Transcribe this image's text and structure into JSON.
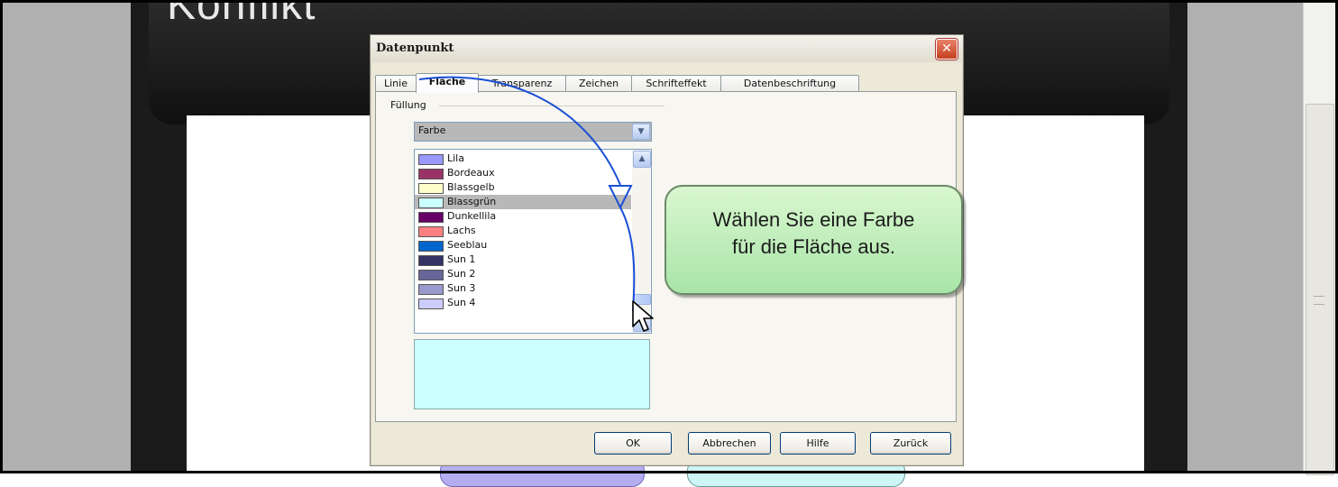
{
  "slide": {
    "title": "Konflikt"
  },
  "dialog": {
    "title": "Datenpunkt",
    "close_label": "✕",
    "tabs": [
      {
        "label": "Linie"
      },
      {
        "label": "Fläche"
      },
      {
        "label": "Transparenz"
      },
      {
        "label": "Zeichen"
      },
      {
        "label": "Schrifteffekt"
      },
      {
        "label": "Datenbeschriftung"
      }
    ],
    "active_tab": "Fläche",
    "fill_group_label": "Füllung",
    "fill_type": "Farbe",
    "colors": [
      {
        "label": "Lila",
        "color": "#9999ff"
      },
      {
        "label": "Bordeaux",
        "color": "#993366"
      },
      {
        "label": "Blassgelb",
        "color": "#ffffcc"
      },
      {
        "label": "Blassgrün",
        "color": "#ccffff",
        "selected": true
      },
      {
        "label": "Dunkellila",
        "color": "#660066"
      },
      {
        "label": "Lachs",
        "color": "#ff8080"
      },
      {
        "label": "Seeblau",
        "color": "#0066cc"
      },
      {
        "label": "Sun 1",
        "color": "#333366"
      },
      {
        "label": "Sun 2",
        "color": "#666699"
      },
      {
        "label": "Sun 3",
        "color": "#9999cc"
      },
      {
        "label": "Sun 4",
        "color": "#ccccff"
      }
    ],
    "preview_color": "#ccffff",
    "buttons": {
      "ok": "OK",
      "cancel": "Abbrechen",
      "help": "Hilfe",
      "back": "Zurück"
    }
  },
  "callout": {
    "line1": "Wählen Sie eine Farbe",
    "line2": "für die Fläche aus."
  }
}
